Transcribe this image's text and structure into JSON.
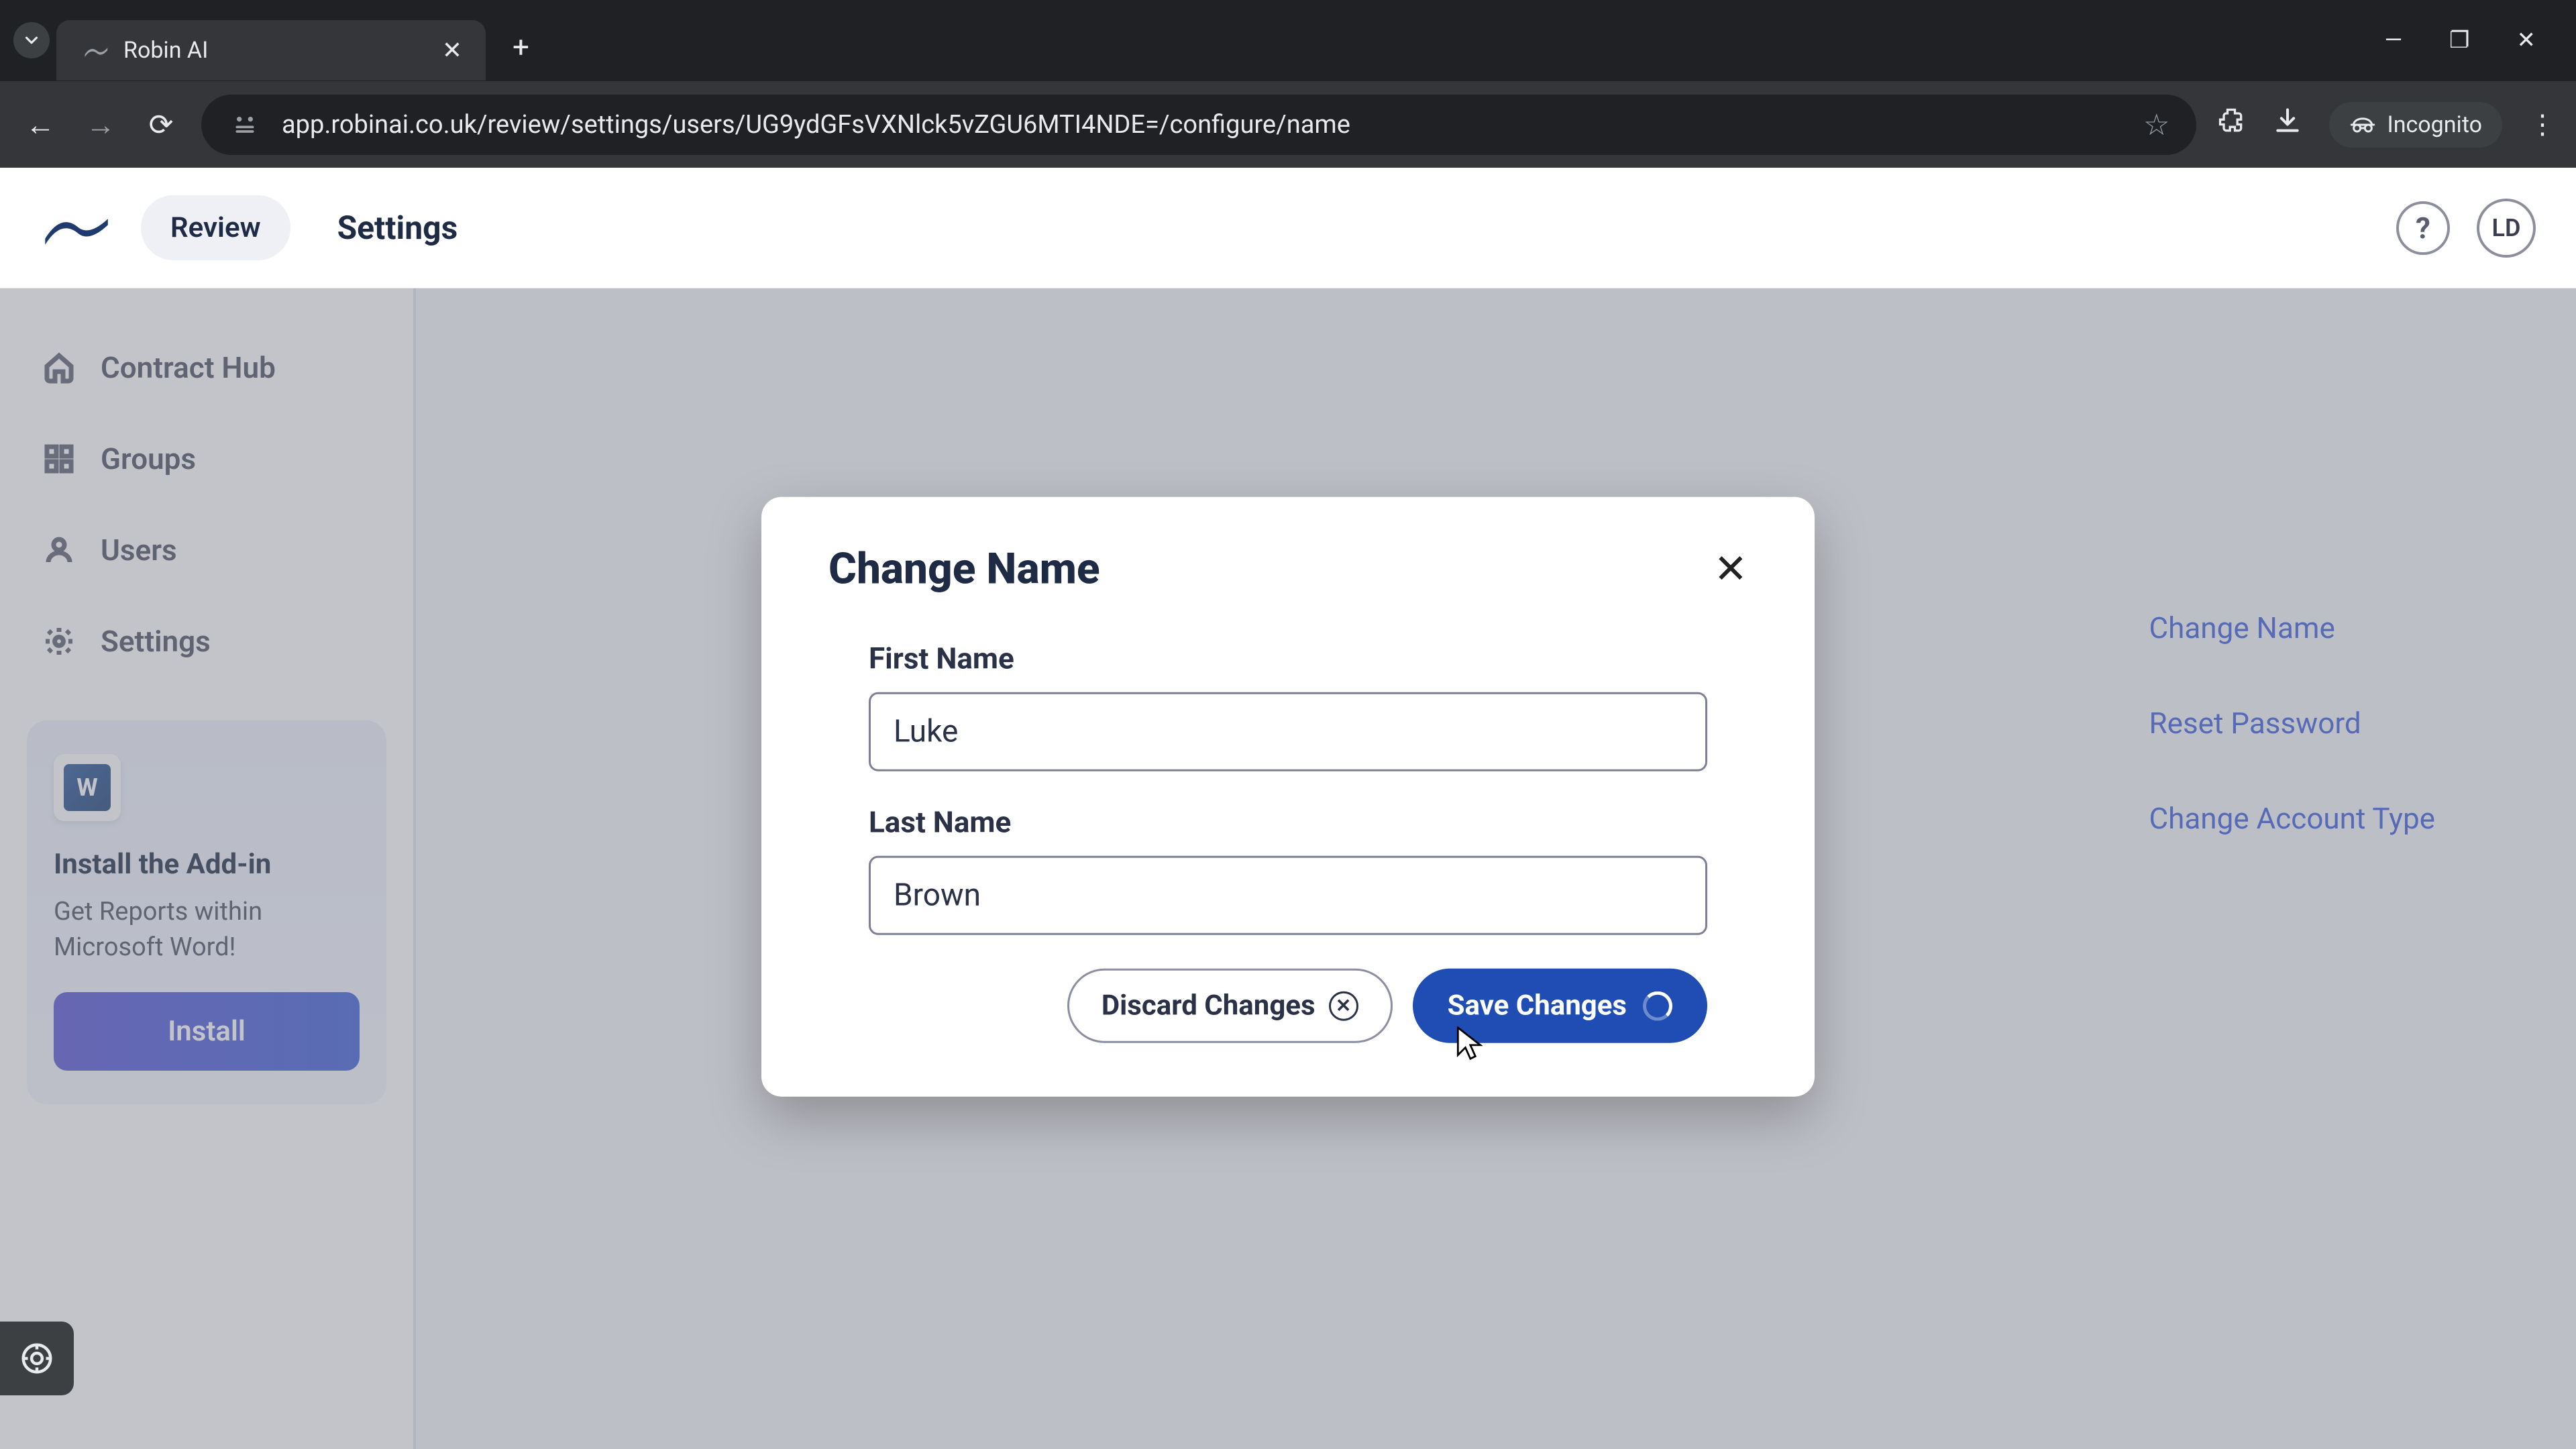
{
  "browser": {
    "tab_title": "Robin AI",
    "url": "app.robinai.co.uk/review/settings/users/UG9ydGFsVXNlck5vZGU6MTI4NDE=/configure/name",
    "incognito_label": "Incognito"
  },
  "header": {
    "review_label": "Review",
    "title": "Settings",
    "avatar_initials": "LD"
  },
  "sidebar": {
    "items": [
      {
        "label": "Contract Hub"
      },
      {
        "label": "Groups"
      },
      {
        "label": "Users"
      },
      {
        "label": "Settings"
      }
    ],
    "addin": {
      "title": "Install the Add-in",
      "desc": "Get Reports within Microsoft Word!",
      "button": "Install",
      "word_letter": "W"
    }
  },
  "bg_links": {
    "change_name": "Change Name",
    "reset_password": "Reset Password",
    "change_account_type": "Change Account Type"
  },
  "modal": {
    "title": "Change Name",
    "first_name_label": "First Name",
    "first_name_value": "Luke",
    "last_name_label": "Last Name",
    "last_name_value": "Brown",
    "discard_label": "Discard Changes",
    "save_label": "Save Changes"
  }
}
